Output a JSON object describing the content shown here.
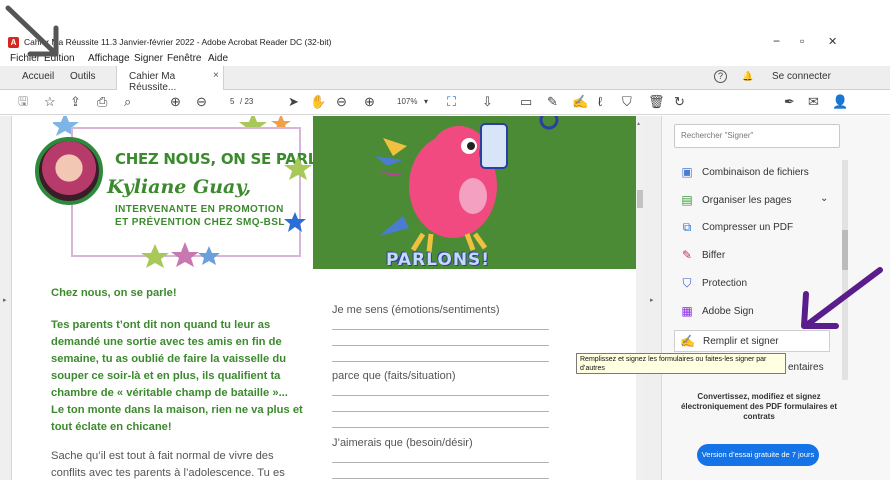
{
  "window": {
    "title": "Cahier Ma Réussite  11.3  Janvier-février 2022 - Adobe Acrobat Reader DC (32-bit)",
    "minimize": "−",
    "maximize": "▫",
    "close": "✕"
  },
  "menu": [
    "Fichier",
    "Édition",
    "Affichage",
    "Signer",
    "Fenêtre",
    "Aide"
  ],
  "tabs": {
    "home": "Accueil",
    "tools": "Outils",
    "document": "Cahier Ma Réussite...",
    "document_close": "×",
    "help": "?",
    "bell": "🔔",
    "signin": "Se connecter"
  },
  "toolbar": {
    "page_current": "5",
    "page_total": "/ 23",
    "zoom": "107%"
  },
  "document": {
    "card_title": "CHEZ NOUS, ON SE PARLE!",
    "card_name": "Kyliane Guay,",
    "card_role_1": "INTERVENANTE EN PROMOTION",
    "card_role_2": "ET PRÉVENTION CHEZ SMQ-BSL",
    "heading": "Chez nous, on se parle!",
    "body_green": [
      "Tes parents t’ont dit non quand tu leur as",
      "demandé une sortie avec tes amis en fin de",
      "semaine, tu as oublié de faire la vaisselle du",
      "souper ce soir-là et en plus, ils qualifient ta",
      "chambre de « véritable champ de bataille »...",
      "Le ton monte dans la maison, rien ne va plus et",
      "tout éclate en chicane!"
    ],
    "body_gray": [
      "Sache qu’il est tout à fait normal de vivre des",
      "conflits avec tes parents à l’adolescence. Tu es"
    ],
    "banner": "PARLONS!",
    "prompt_1": "Je me sens (émotions/sentiments)",
    "prompt_2": "parce que (faits/situation)",
    "prompt_3": "J’aimerais que (besoin/désir)",
    "dash_line": "________________________________________________"
  },
  "panel": {
    "search_placeholder": "Rechercher \"Signer\"",
    "tools": [
      {
        "label": "Combinaison de fichiers",
        "icon": "combine-icon",
        "color": "#4a7ccf"
      },
      {
        "label": "Organiser les pages",
        "icon": "organize-icon",
        "color": "#3a9a3a"
      },
      {
        "label": "Compresser un PDF",
        "icon": "compress-icon",
        "color": "#2a6fd6"
      },
      {
        "label": "Biffer",
        "icon": "redact-icon",
        "color": "#c0306a"
      },
      {
        "label": "Protection",
        "icon": "shield-icon",
        "color": "#3a55c8"
      },
      {
        "label": "Adobe Sign",
        "icon": "sign-icon",
        "color": "#8a2be2"
      },
      {
        "label": "Remplir et signer",
        "icon": "fill-sign-icon",
        "color": "#8a2be2"
      }
    ],
    "comments_partial": "entaires",
    "promo_text": "Convertissez, modifiez et signez électroniquement des PDF formulaires et contrats",
    "trial_button": "Version d’essai gratuite de 7 jours",
    "tooltip": "Remplissez et signez les formulaires ou faites-les signer par d’autres"
  },
  "colors": {
    "accent_blue": "#1473e6",
    "green_text": "#3c8a2e",
    "annotation_arrow": "#5a1e8c"
  }
}
